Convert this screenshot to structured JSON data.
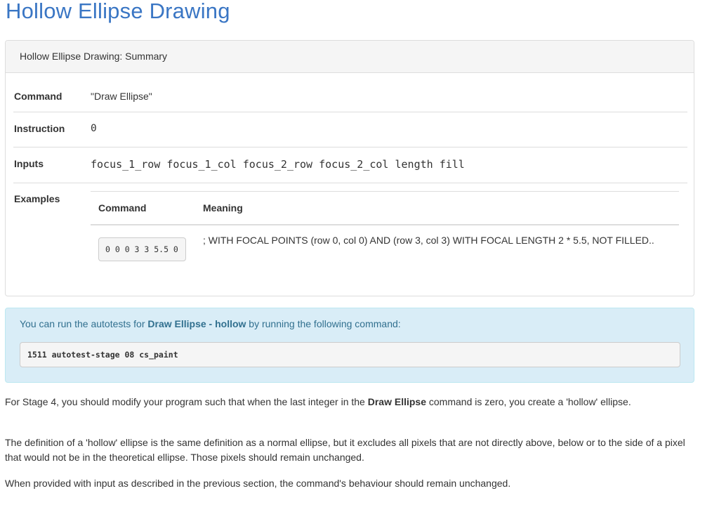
{
  "page": {
    "title": "Hollow Ellipse Drawing"
  },
  "summary_panel": {
    "heading": "Hollow Ellipse Drawing: Summary",
    "rows": {
      "command": {
        "label": "Command",
        "value": "\"Draw Ellipse\""
      },
      "instruction": {
        "label": "Instruction",
        "value": "0"
      },
      "inputs": {
        "label": "Inputs",
        "value": "focus_1_row focus_1_col focus_2_row focus_2_col length fill"
      },
      "examples": {
        "label": "Examples"
      }
    },
    "examples_table": {
      "headers": {
        "command": "Command",
        "meaning": "Meaning"
      },
      "rows": [
        {
          "command": "0 0 0 3 3 5.5 0",
          "meaning": "; WITH FOCAL POINTS (row 0, col 0) AND (row 3, col 3) WITH FOCAL LENGTH 2 * 5.5, NOT FILLED.."
        }
      ]
    }
  },
  "autotest_alert": {
    "text_before": "You can run the autotests for ",
    "emphasis": "Draw Ellipse - hollow",
    "text_after": " by running the following command:",
    "command": "1511 autotest-stage 08 cs_paint"
  },
  "paragraphs": {
    "p1": {
      "before": "For Stage 4, you should modify your program such that when the last integer in the ",
      "bold": "Draw Ellipse",
      "after": " command is zero, you create a 'hollow' ellipse."
    },
    "p2": "The definition of a 'hollow' ellipse is the same definition as a normal ellipse, but it excludes all pixels that are not directly above, below or to the side of a pixel that would not be in the theoretical ellipse. Those pixels should remain unchanged.",
    "p3": "When provided with input as described in the previous section, the command's behaviour should remain unchanged."
  },
  "colors": {
    "title": "#3a76c4",
    "alert_background": "#d9edf7",
    "alert_text": "#31708f",
    "panel_heading_background": "#f5f5f5"
  }
}
